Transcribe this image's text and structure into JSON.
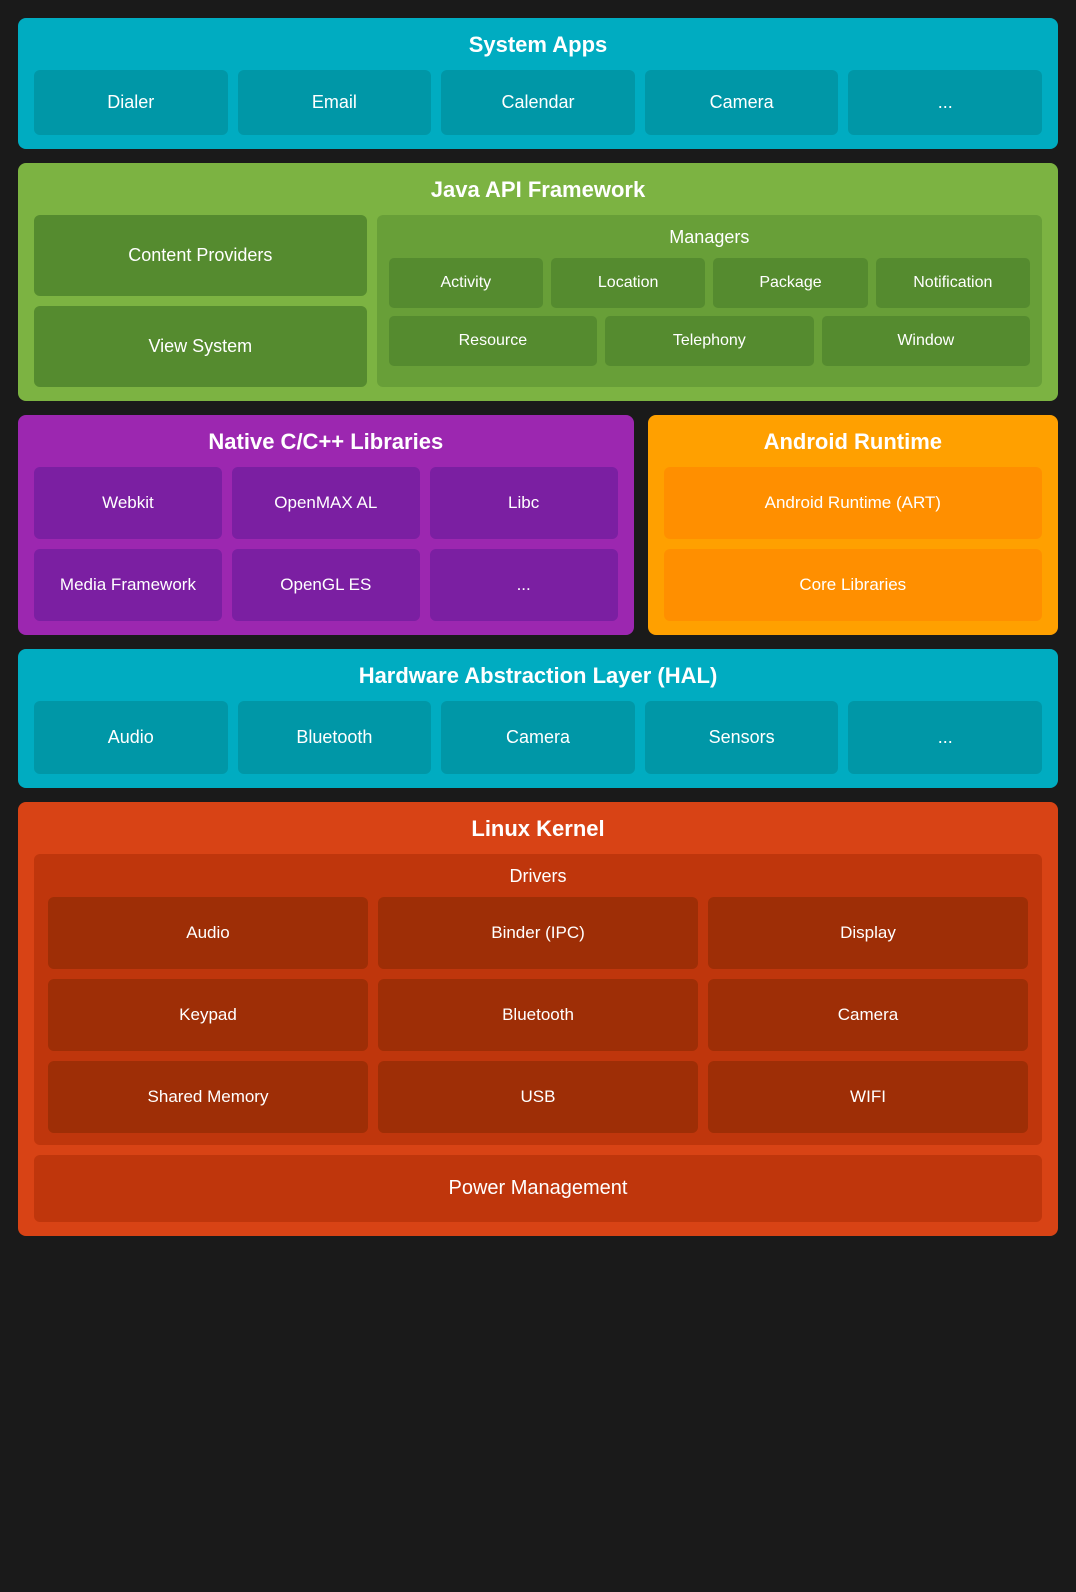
{
  "systemApps": {
    "title": "System Apps",
    "apps": [
      "Dialer",
      "Email",
      "Calendar",
      "Camera",
      "..."
    ]
  },
  "javaApi": {
    "title": "Java API Framework",
    "left": [
      "Content Providers",
      "View System"
    ],
    "managersTitle": "Managers",
    "managersRow1": [
      "Activity",
      "Location",
      "Package",
      "Notification"
    ],
    "managersRow2": [
      "Resource",
      "Telephony",
      "Window"
    ]
  },
  "nativeCpp": {
    "title": "Native C/C++ Libraries",
    "libs": [
      "Webkit",
      "OpenMAX AL",
      "Libc",
      "Media Framework",
      "OpenGL ES",
      "..."
    ]
  },
  "androidRuntime": {
    "title": "Android Runtime",
    "items": [
      "Android Runtime (ART)",
      "Core Libraries"
    ]
  },
  "hal": {
    "title": "Hardware Abstraction Layer (HAL)",
    "items": [
      "Audio",
      "Bluetooth",
      "Camera",
      "Sensors",
      "..."
    ]
  },
  "linuxKernel": {
    "title": "Linux Kernel",
    "driversTitle": "Drivers",
    "drivers": [
      "Audio",
      "Binder (IPC)",
      "Display",
      "Keypad",
      "Bluetooth",
      "Camera",
      "Shared Memory",
      "USB",
      "WIFI"
    ],
    "powerManagement": "Power Management"
  }
}
